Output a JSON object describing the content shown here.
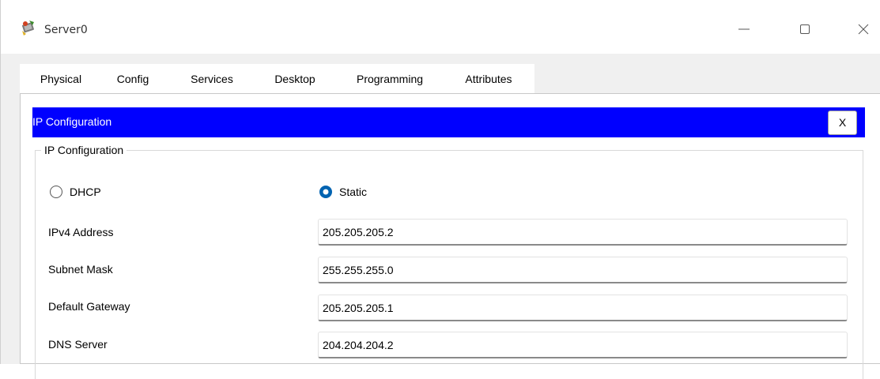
{
  "window": {
    "title": "Server0",
    "icon": "server-app-icon",
    "controls": [
      "minimize-icon",
      "maximize-icon",
      "close-icon"
    ]
  },
  "tabs": [
    {
      "label": "Physical",
      "active": false
    },
    {
      "label": "Config",
      "active": false
    },
    {
      "label": "Services",
      "active": false
    },
    {
      "label": "Desktop",
      "active": true
    },
    {
      "label": "Programming",
      "active": false
    },
    {
      "label": "Attributes",
      "active": false
    }
  ],
  "ip_config": {
    "header_title": "IP Configuration",
    "close_label": "X",
    "group_title": "IP Configuration",
    "mode": {
      "dhcp_label": "DHCP",
      "static_label": "Static",
      "selected": "Static"
    },
    "fields": {
      "ipv4_label": "IPv4 Address",
      "ipv4_value": "205.205.205.2",
      "subnet_label": "Subnet Mask",
      "subnet_value": "255.255.255.0",
      "gateway_label": "Default Gateway",
      "gateway_value": "205.205.205.1",
      "dns_label": "DNS Server",
      "dns_value": "204.204.204.2"
    }
  },
  "colors": {
    "header_bg": "#0000ff",
    "active_tab_underline": "#1b4a8f",
    "radio_selected": "#0063b1"
  }
}
